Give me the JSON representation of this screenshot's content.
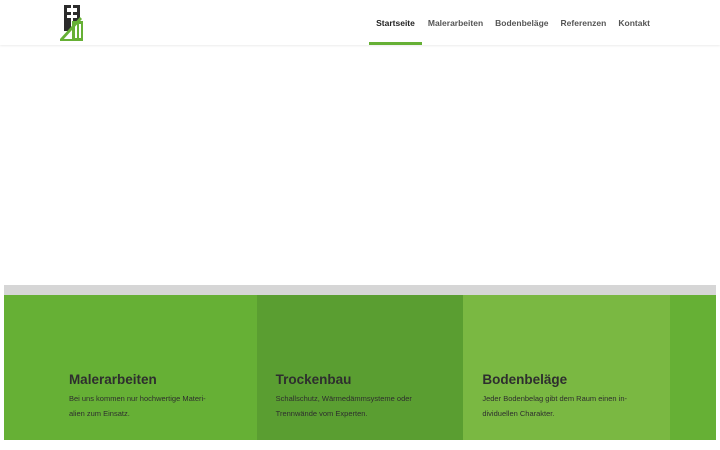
{
  "nav": {
    "items": [
      {
        "label": "Startseite",
        "active": true
      },
      {
        "label": "Malerarbeiten",
        "active": false
      },
      {
        "label": "Bodenbeläge",
        "active": false
      },
      {
        "label": "Referenzen",
        "active": false
      },
      {
        "label": "Kontakt",
        "active": false
      }
    ]
  },
  "colors": {
    "accent": "#66b035",
    "card1": "#66b035",
    "card2": "#5a9e31",
    "card3": "#7ab842",
    "edge": "#66b035",
    "divider": "#d6d6d6"
  },
  "services": [
    {
      "title": "Malerarbeiten",
      "text_line1": "Bei uns kommen nur hochwertige Materi-",
      "text_line2": "alien zum Einsatz."
    },
    {
      "title": "Trockenbau",
      "text_line1": "Schallschutz, Wärmedämmsysteme oder",
      "text_line2": "Trennwände vom Experten."
    },
    {
      "title": "Bodenbeläge",
      "text_line1": "Jeder Bodenbelag gibt dem Raum einen in-",
      "text_line2": "dividuellen Charakter."
    }
  ]
}
